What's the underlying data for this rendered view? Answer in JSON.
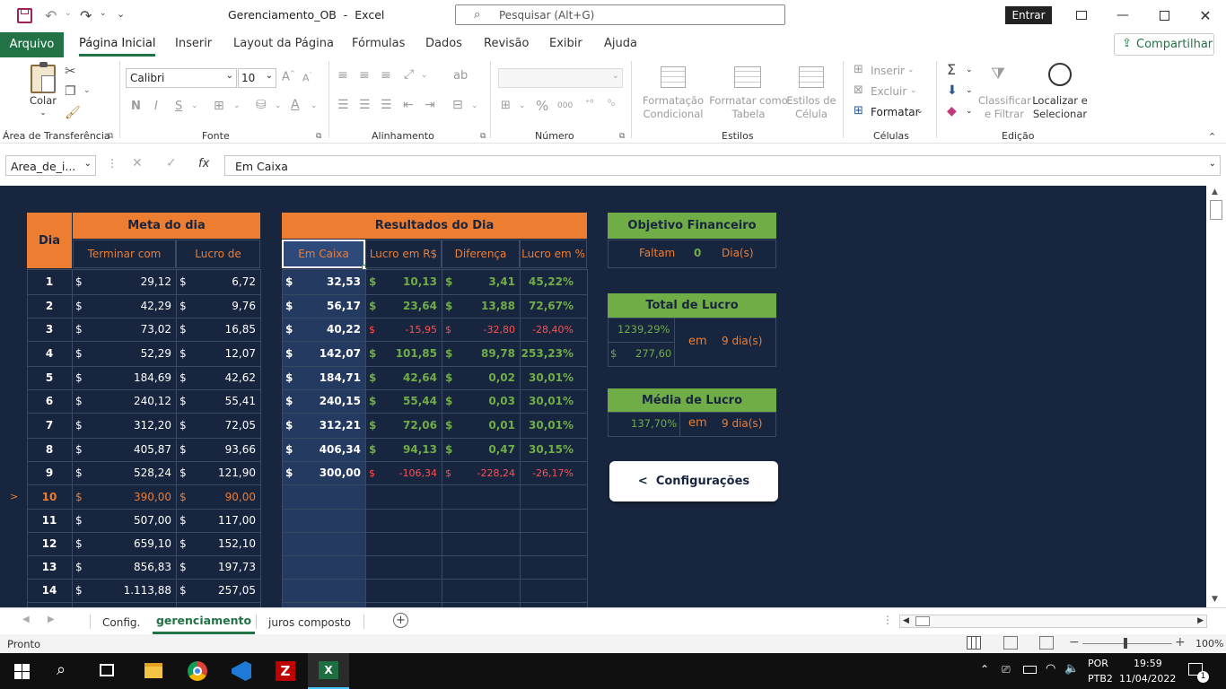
{
  "titlebar": {
    "doc_title": "Gerenciamento_OB  -  Excel",
    "search_placeholder": "Pesquisar (Alt+G)",
    "signin_label": "Entrar"
  },
  "ribbon_tabs": [
    "Arquivo",
    "Página Inicial",
    "Inserir",
    "Layout da Página",
    "Fórmulas",
    "Dados",
    "Revisão",
    "Exibir",
    "Ajuda"
  ],
  "share_label": "Compartilhar",
  "ribbon": {
    "paste_label": "Colar",
    "font_name": "Calibri",
    "font_size": "10",
    "cond_format": "Formatação Condicional",
    "format_table": "Formatar como Tabela",
    "cell_styles": "Estilos de Célula",
    "insert": "Inserir",
    "delete": "Excluir",
    "format": "Formatar",
    "sort_filter": "Classificar e Filtrar",
    "find_select": "Localizar e Selecionar",
    "groups": [
      "Área de Transferência",
      "Fonte",
      "Alinhamento",
      "Número",
      "Estilos",
      "Células",
      "Edição"
    ]
  },
  "formula_bar": {
    "name_box": "Area_de_i...",
    "fx": "fx",
    "content": "Em Caixa"
  },
  "sheet": {
    "dia_label": "Dia",
    "meta_title": "Meta do dia",
    "meta_sub": [
      "Terminar com",
      "Lucro de"
    ],
    "result_title": "Resultados do Dia",
    "result_sub": [
      "Em Caixa",
      "Lucro em R$",
      "Diferença",
      "Lucro em %"
    ],
    "currency": "$",
    "row_marker": ">",
    "rows": [
      {
        "dia": "1",
        "terminar": "29,12",
        "lucro": "6,72",
        "caixa": "32,53",
        "lucro_rs": "10,13",
        "dif": "3,41",
        "pct": "45,22%",
        "neg": false
      },
      {
        "dia": "2",
        "terminar": "42,29",
        "lucro": "9,76",
        "caixa": "56,17",
        "lucro_rs": "23,64",
        "dif": "13,88",
        "pct": "72,67%",
        "neg": false
      },
      {
        "dia": "3",
        "terminar": "73,02",
        "lucro": "16,85",
        "caixa": "40,22",
        "lucro_rs": "-15,95",
        "dif": "-32,80",
        "pct": "-28,40%",
        "neg": true
      },
      {
        "dia": "4",
        "terminar": "52,29",
        "lucro": "12,07",
        "caixa": "142,07",
        "lucro_rs": "101,85",
        "dif": "89,78",
        "pct": "253,23%",
        "neg": false
      },
      {
        "dia": "5",
        "terminar": "184,69",
        "lucro": "42,62",
        "caixa": "184,71",
        "lucro_rs": "42,64",
        "dif": "0,02",
        "pct": "30,01%",
        "neg": false
      },
      {
        "dia": "6",
        "terminar": "240,12",
        "lucro": "55,41",
        "caixa": "240,15",
        "lucro_rs": "55,44",
        "dif": "0,03",
        "pct": "30,01%",
        "neg": false
      },
      {
        "dia": "7",
        "terminar": "312,20",
        "lucro": "72,05",
        "caixa": "312,21",
        "lucro_rs": "72,06",
        "dif": "0,01",
        "pct": "30,01%",
        "neg": false
      },
      {
        "dia": "8",
        "terminar": "405,87",
        "lucro": "93,66",
        "caixa": "406,34",
        "lucro_rs": "94,13",
        "dif": "0,47",
        "pct": "30,15%",
        "neg": false
      },
      {
        "dia": "9",
        "terminar": "528,24",
        "lucro": "121,90",
        "caixa": "300,00",
        "lucro_rs": "-106,34",
        "dif": "-228,24",
        "pct": "-26,17%",
        "neg": true
      },
      {
        "dia": "10",
        "terminar": "390,00",
        "lucro": "90,00",
        "current": true
      },
      {
        "dia": "11",
        "terminar": "507,00",
        "lucro": "117,00"
      },
      {
        "dia": "12",
        "terminar": "659,10",
        "lucro": "152,10"
      },
      {
        "dia": "13",
        "terminar": "856,83",
        "lucro": "197,73"
      },
      {
        "dia": "14",
        "terminar": "1.113,88",
        "lucro": "257,05"
      }
    ],
    "objetivo": {
      "title": "Objetivo Financeiro",
      "faltam": "Faltam",
      "value": "0",
      "dias": "Dia(s)"
    },
    "total": {
      "title": "Total de Lucro",
      "pct": "1239,29%",
      "currency": "$",
      "value": "277,60",
      "em": "em",
      "dias": "9 dia(s)"
    },
    "media": {
      "title": "Média de Lucro",
      "pct": "137,70%",
      "em": "em",
      "dias": "9 dia(s)"
    },
    "config_button": "<  Configurações"
  },
  "sheet_tabs": [
    "Config.",
    "gerenciamento",
    "juros composto"
  ],
  "status": {
    "ready": "Pronto",
    "zoom": "100%"
  },
  "taskbar": {
    "lang1": "POR",
    "lang2": "PTB2",
    "time": "19:59",
    "date": "11/04/2022",
    "notif": "1"
  },
  "colors": {
    "accent": "#217346",
    "navy": "#18253f",
    "orange": "#ed7d31",
    "green": "#70ad47"
  }
}
